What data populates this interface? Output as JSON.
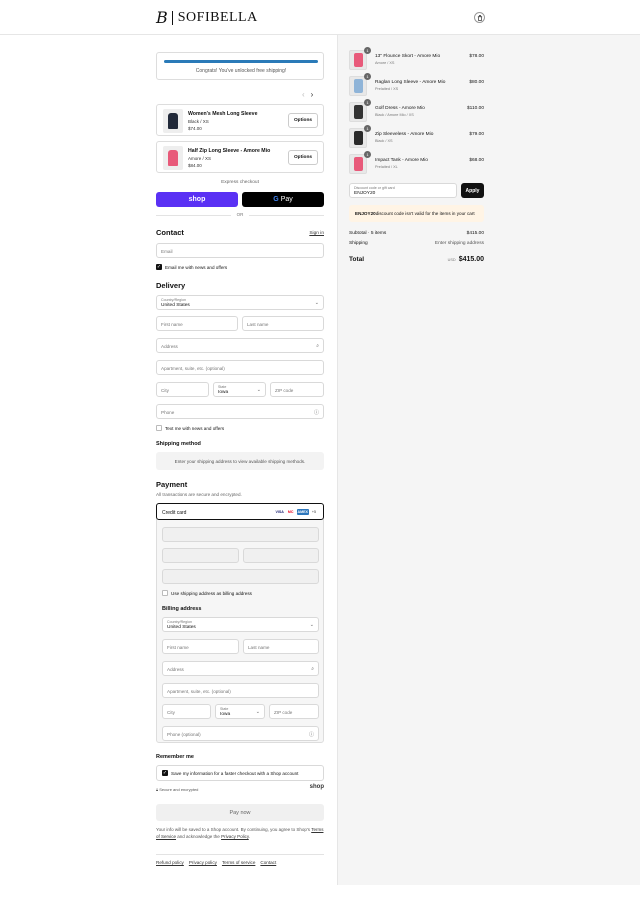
{
  "header": {
    "logo_mark": "B",
    "logo_text": "SOFIBELLA",
    "cart_icon": "shopping-bag-icon"
  },
  "shipping_banner": {
    "message": "Congrats! You've unlocked free shipping!",
    "progress": 1.0,
    "color": "#2a7ab8"
  },
  "carousel": {
    "prev": "‹",
    "next": "›"
  },
  "upsells": [
    {
      "title": "Women's Mesh Long Sleeve",
      "variant": "Black / XS",
      "price": "$74.00",
      "button": "Options",
      "color": "#222a3a"
    },
    {
      "title": "Half Zip Long Sleeve - Amore Mio",
      "variant": "Amore / XS",
      "price": "$84.00",
      "button": "Options",
      "color": "#e85a7a"
    }
  ],
  "express": {
    "label": "Express checkout",
    "shop_label": "shop",
    "gpay_g": "G",
    "gpay_label": "Pay",
    "or_label": "OR"
  },
  "contact": {
    "heading": "Contact",
    "sign_in": "Sign in",
    "email_placeholder": "Email",
    "news_label": "Email me with news and offers",
    "news_checked": true
  },
  "delivery": {
    "heading": "Delivery",
    "country_label": "Country/Region",
    "country_value": "United States",
    "first_name": "First name",
    "last_name": "Last name",
    "address": "Address",
    "apartment": "Apartment, suite, etc. (optional)",
    "city": "City",
    "state_label": "State",
    "state_value": "Iowa",
    "zip": "ZIP code",
    "phone": "Phone",
    "text_label": "Text me with news and offers",
    "text_checked": false
  },
  "shipping_method": {
    "heading": "Shipping method",
    "note": "Enter your shipping address to view available shipping methods."
  },
  "payment": {
    "heading": "Payment",
    "subtitle": "All transactions are secure and encrypted.",
    "credit_card": "Credit card",
    "cards": [
      {
        "name": "VISA",
        "bg": "#fff",
        "fg": "#1a1f71"
      },
      {
        "name": "MC",
        "bg": "#fff",
        "fg": "#eb001b"
      },
      {
        "name": "AMEX",
        "bg": "#2e77bc",
        "fg": "#fff"
      },
      {
        "name": "+5",
        "bg": "#fff",
        "fg": "#333"
      }
    ],
    "use_shipping_label": "Use shipping address as billing address",
    "use_shipping_checked": false,
    "billing_heading": "Billing address",
    "country_label": "Country/Region",
    "country_value": "United States",
    "first_name": "First name",
    "last_name": "Last name",
    "address": "Address",
    "apartment": "Apartment, suite, etc. (optional)",
    "city": "City",
    "state_label": "State",
    "state_value": "Iowa",
    "zip": "ZIP code",
    "phone": "Phone (optional)"
  },
  "remember": {
    "heading": "Remember me",
    "save_label": "Save my information for a faster checkout with a Shop account",
    "save_checked": true,
    "secure": "Secure and encrypted",
    "shop": "shop"
  },
  "pay_now": "Pay now",
  "legal": {
    "line1": "Your info will be saved to a Shop account. By continuing, you agree to Shop's",
    "tos": "Terms of Service",
    "and": " and acknowledge the ",
    "privacy": "Privacy Policy",
    "end": "."
  },
  "footer_links": [
    "Refund policy",
    "Privacy policy",
    "Terms of service",
    "Contact"
  ],
  "order_items": [
    {
      "qty": "1",
      "name": "13\" Flounce Skort - Amore Mio",
      "variant": "Amore / XS",
      "price": "$78.00",
      "color": "#e85a7a"
    },
    {
      "qty": "1",
      "name": "Raglan Long Sleeve - Amore Mio",
      "variant": "Prelaited / XS",
      "price": "$80.00",
      "color": "#8fb4d8"
    },
    {
      "qty": "1",
      "name": "Golf Dress - Amore Mio",
      "variant": "Black / Amore Mio / XS",
      "price": "$110.00",
      "color": "#333333"
    },
    {
      "qty": "1",
      "name": "Zip Sleeveless - Amore Mio",
      "variant": "Black / XS",
      "price": "$79.00",
      "color": "#2a2a2a"
    },
    {
      "qty": "1",
      "name": "Impact Tank - Amore Mio",
      "variant": "Prelaited / XL",
      "price": "$68.00",
      "color": "#e85a7a"
    }
  ],
  "discount": {
    "label": "Discount code or gift card",
    "value": "ENJOY20",
    "apply": "Apply",
    "warning_code": "ENJOY20",
    "warning_text": " discount code isn't valid for the items in your cart"
  },
  "summary": {
    "subtotal_label": "Subtotal · 5 items",
    "subtotal": "$415.00",
    "shipping_label": "Shipping",
    "shipping_value": "Enter shipping address",
    "total_label": "Total",
    "currency": "USD",
    "total": "$415.00"
  }
}
